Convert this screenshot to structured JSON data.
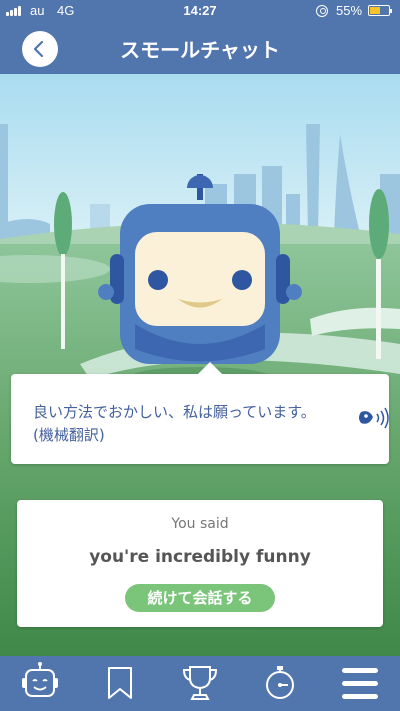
{
  "status_bar": {
    "carrier": "au",
    "network": "4G",
    "time": "14:27",
    "battery_percent": "55%",
    "battery_level": 0.55
  },
  "header": {
    "back_icon": "chevron-left-icon",
    "title": "スモールチャット"
  },
  "bubble": {
    "text": "良い方法でおかしい、私は願っています。 (機械翻訳)",
    "speaker_icon": "speaker-icon"
  },
  "result_card": {
    "label": "You said",
    "phrase": "you're incredibly funny",
    "continue_label": "続けて会話する"
  },
  "tab_bar": {
    "items": [
      {
        "icon": "robot-icon"
      },
      {
        "icon": "bookmark-icon"
      },
      {
        "icon": "trophy-icon"
      },
      {
        "icon": "stopwatch-icon"
      },
      {
        "icon": "menu-icon"
      }
    ]
  },
  "colors": {
    "header_blue": "#5175ad",
    "bubble_text": "#44619e",
    "continue_button": "#7bc57b",
    "battery": "#f5c32c"
  }
}
